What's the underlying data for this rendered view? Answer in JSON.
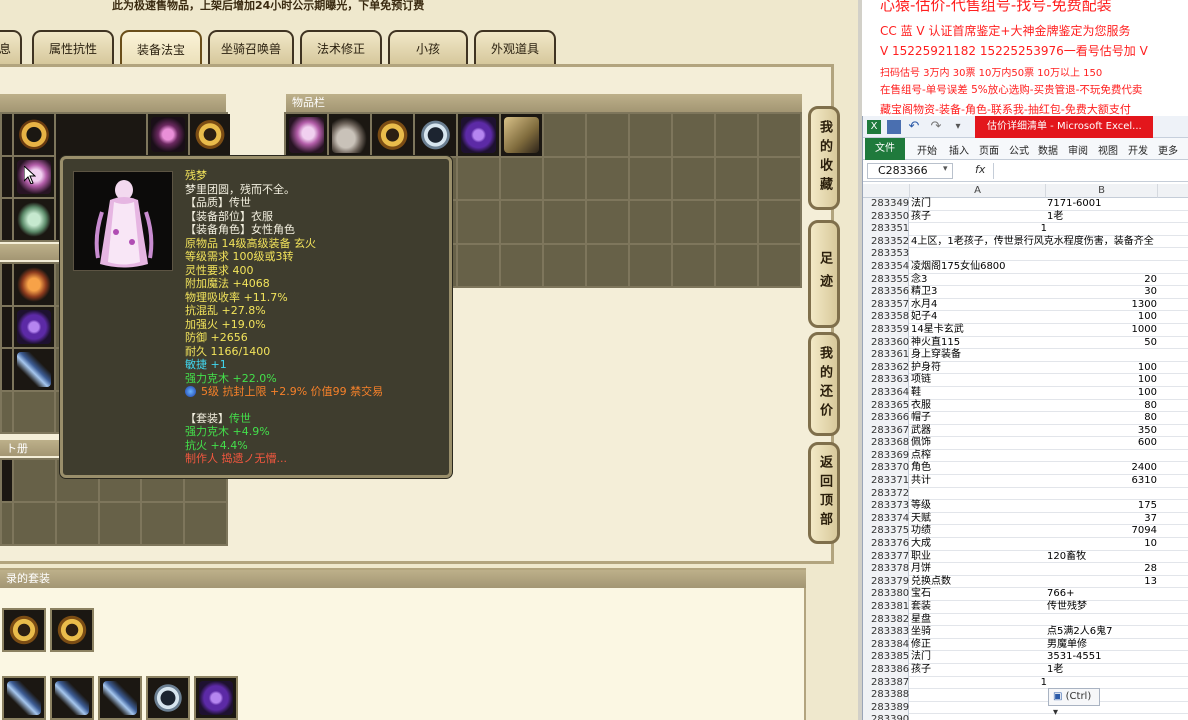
{
  "game": {
    "notice": "此为极速售物品，上架后增加24小时公示期曝光，下单免预订费",
    "tabs": [
      "息",
      "属性抗性",
      "装备法宝",
      "坐骑召唤兽",
      "法术修正",
      "小孩",
      "外观道具"
    ],
    "panels": {
      "inventory_title": "物品栏",
      "left_mid_title": "ト册",
      "bottom_title": "录的套装"
    },
    "side_buttons": [
      {
        "label": "我的收藏"
      },
      {
        "label": "足迹"
      },
      {
        "label": "我的还价"
      },
      {
        "label": "返回顶部"
      }
    ],
    "tooltip": {
      "name": "残梦",
      "desc": "梦里团圆，残而不全。",
      "quality": "【品质】传世",
      "slot": "【装备部位】衣服",
      "role": "【装备角色】女性角色",
      "origin": "原物品 14级高级装备 玄火",
      "level_req": "等级需求 100级或3转",
      "spirit_req": "灵性要求 400",
      "magic": "附加魔法 +4068",
      "phys": "物理吸收率 +11.7%",
      "chaos": "抗混乱 +27.8%",
      "fire_boost": "加强火 +19.0%",
      "defense": "防御 +2656",
      "durability": "耐久 1166/1400",
      "agility": "敏捷 +1",
      "wood": "强力克木 +22.0%",
      "gem_line": "5级 抗封上限 +2.9% 价值99 禁交易",
      "set_label": "【套装】",
      "set_name": "传世",
      "set_wood": "强力克木 +4.9%",
      "set_fire": "抗火 +4.4%",
      "maker": "制作人 捣遗ノ无懵..."
    }
  },
  "promo": {
    "lines": [
      "心猿-估价-代售组号-找号-免费配装",
      "CC 蓝 V 认证首席鉴定+大神金牌鉴定为您服务",
      "V 15225921182        15225253976一看号估号加 V",
      "扫码估号 3万内 30票 10万内50票 10万以上 150",
      "在售组号-单号误差 5%放心选购-买贵管退-不玩免费代卖",
      "藏宝阁物资-装备-角色-联系我-抽红包-免费大额支付"
    ]
  },
  "excel": {
    "window_title": "估价详细清单 - Microsoft Excel...",
    "ribbon_tabs": [
      "文件",
      "开始",
      "插入",
      "页面",
      "公式",
      "数据",
      "审阅",
      "视图",
      "开发",
      "更多"
    ],
    "name_box": "C283366",
    "fx_label": "fx",
    "col_a": "A",
    "col_b": "B",
    "paste_tag": "(Ctrl)",
    "rows": [
      {
        "n": "283349",
        "a": "法门",
        "b": "7171-6001"
      },
      {
        "n": "283350",
        "a": "孩子",
        "b": "1老"
      },
      {
        "n": "283351",
        "a": "1",
        "b": "",
        "anum": true
      },
      {
        "n": "283352",
        "a": "4上区，1老孩子，传世景行风克水程度伤害，装备齐全",
        "b": ""
      },
      {
        "n": "283353",
        "a": "",
        "b": ""
      },
      {
        "n": "283354",
        "a": "凌烟阁175女仙6800",
        "b": ""
      },
      {
        "n": "283355",
        "a": "念3",
        "b": "20",
        "bnum": true
      },
      {
        "n": "283356",
        "a": "精卫3",
        "b": "30",
        "bnum": true
      },
      {
        "n": "283357",
        "a": "水月4",
        "b": "1300",
        "bnum": true
      },
      {
        "n": "283358",
        "a": "妃子4",
        "b": "100",
        "bnum": true
      },
      {
        "n": "283359",
        "a": "14星卡玄武",
        "b": "1000",
        "bnum": true
      },
      {
        "n": "283360",
        "a": "神火直115",
        "b": "50",
        "bnum": true
      },
      {
        "n": "283361",
        "a": "身上穿装备",
        "b": ""
      },
      {
        "n": "283362",
        "a": "护身符",
        "b": "100",
        "bnum": true
      },
      {
        "n": "283363",
        "a": "项链",
        "b": "100",
        "bnum": true
      },
      {
        "n": "283364",
        "a": "鞋",
        "b": "100",
        "bnum": true
      },
      {
        "n": "283365",
        "a": "衣服",
        "b": "80",
        "bnum": true
      },
      {
        "n": "283366",
        "a": "帽子",
        "b": "80",
        "bnum": true
      },
      {
        "n": "283367",
        "a": "武器",
        "b": "350",
        "bnum": true
      },
      {
        "n": "283368",
        "a": "佩饰",
        "b": "600",
        "bnum": true
      },
      {
        "n": "283369",
        "a": "点榨",
        "b": ""
      },
      {
        "n": "283370",
        "a": "角色",
        "b": "2400",
        "bnum": true
      },
      {
        "n": "283371",
        "a": "共计",
        "b": "6310",
        "bnum": true
      },
      {
        "n": "283372",
        "a": "",
        "b": ""
      },
      {
        "n": "283373",
        "a": "等级",
        "b": "175",
        "bnum": true
      },
      {
        "n": "283374",
        "a": "天赋",
        "b": "37",
        "bnum": true
      },
      {
        "n": "283375",
        "a": "功绩",
        "b": "7094",
        "bnum": true
      },
      {
        "n": "283376",
        "a": "大成",
        "b": "10",
        "bnum": true
      },
      {
        "n": "283377",
        "a": "职业",
        "b": "120畜牧"
      },
      {
        "n": "283378",
        "a": "月饼",
        "b": "28",
        "bnum": true
      },
      {
        "n": "283379",
        "a": "兑换点数",
        "b": "13",
        "bnum": true
      },
      {
        "n": "283380",
        "a": "宝石",
        "b": "766+"
      },
      {
        "n": "283381",
        "a": "套装",
        "b": "传世残梦"
      },
      {
        "n": "283382",
        "a": "星盘",
        "b": ""
      },
      {
        "n": "283383",
        "a": "坐骑",
        "b": "点5满2人6鬼7"
      },
      {
        "n": "283384",
        "a": "修正",
        "b": "男魔单修"
      },
      {
        "n": "283385",
        "a": "法门",
        "b": "3531-4551"
      },
      {
        "n": "283386",
        "a": "孩子",
        "b": "1老"
      },
      {
        "n": "283387",
        "a": "1",
        "b": "",
        "anum": true
      },
      {
        "n": "283388",
        "a": "",
        "b": ""
      },
      {
        "n": "283389",
        "a": "",
        "b": ""
      },
      {
        "n": "283390",
        "a": "",
        "b": ""
      }
    ]
  },
  "colors": {
    "promo_red": "#ff1f1f",
    "excel_green": "#1f7a3c",
    "title_red": "#e3161c"
  }
}
